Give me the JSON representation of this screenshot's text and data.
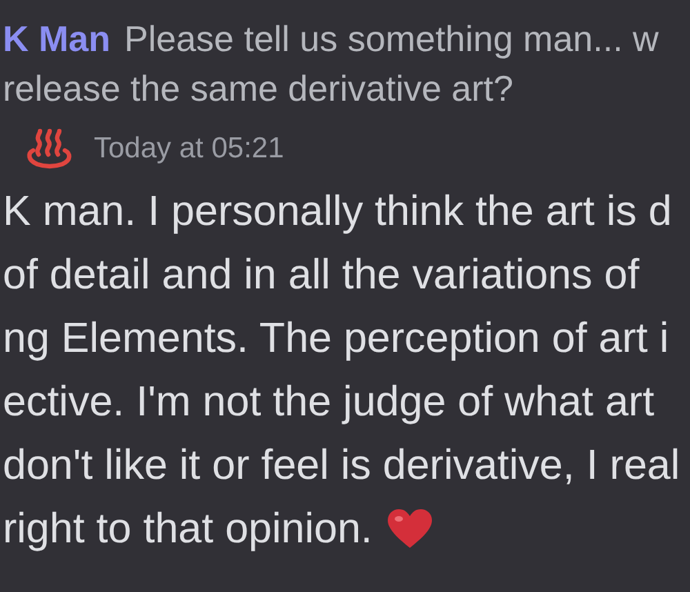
{
  "reply": {
    "author": "K Man",
    "text_lines": [
      "Please tell us something man... w",
      "release the same derivative art?"
    ]
  },
  "message": {
    "timestamp": "Today at 05:21",
    "lines": [
      "K man. I personally think the art is d",
      "of detail and in all the variations of",
      "ng Elements. The perception of art i",
      "ective. I'm not the judge of what art",
      "don't like it or feel is derivative, I real",
      "right to that opinion."
    ]
  }
}
